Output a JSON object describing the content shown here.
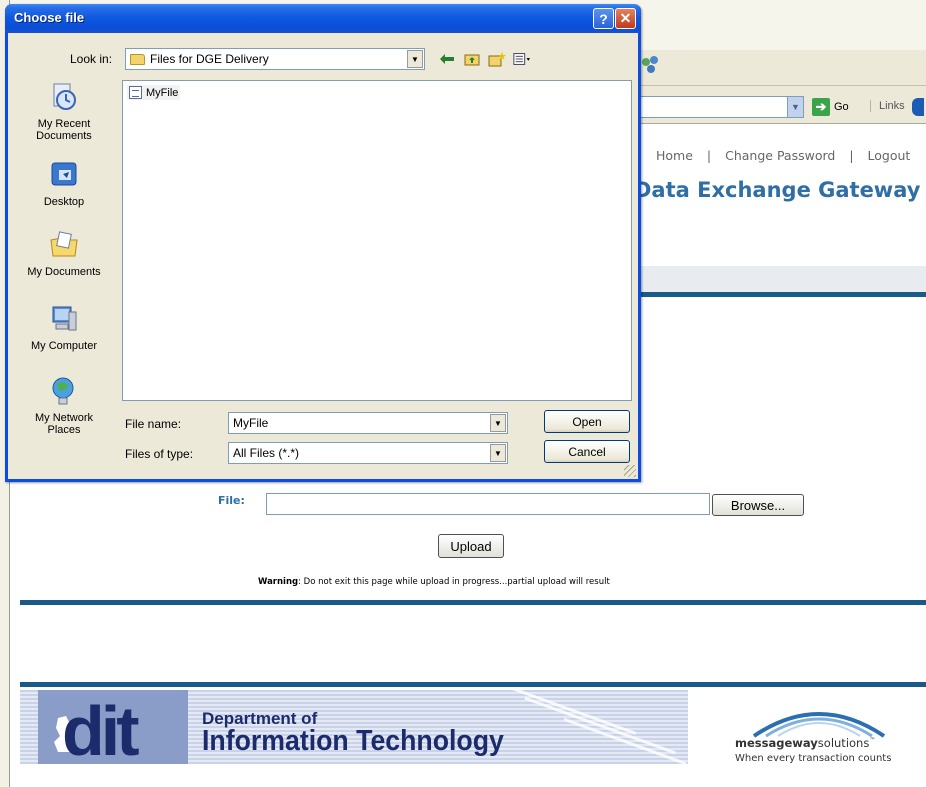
{
  "browser": {
    "go_label": "Go",
    "links_label": "Links"
  },
  "page": {
    "nav": {
      "home": "Home",
      "separator": "|",
      "change_password": "Change Password",
      "logout": "Logout"
    },
    "title_partial": "Data Exchange Gateway",
    "file_label": "File:",
    "file_value": "",
    "browse_label": "Browse...",
    "upload_label": "Upload",
    "warning_bold": "Warning",
    "warning_text": ": Do not exit this page while upload in progress...partial upload will result"
  },
  "footer": {
    "dit_letters": "dit",
    "dit_line1": "Department of",
    "dit_line2": "Information Technology",
    "mw_name_bold": "messageway",
    "mw_name_rest": "solutions",
    "mw_tm": "™",
    "mw_tagline": "When every transaction counts"
  },
  "dialog": {
    "title": "Choose file",
    "help_label": "?",
    "close_label": "✕",
    "look_in_label": "Look in:",
    "look_in_value": "Files for DGE Delivery",
    "places": [
      {
        "label": "My Recent Documents",
        "icon": "recent-documents-icon"
      },
      {
        "label": "Desktop",
        "icon": "desktop-icon"
      },
      {
        "label": "My Documents",
        "icon": "my-documents-icon"
      },
      {
        "label": "My Computer",
        "icon": "my-computer-icon"
      },
      {
        "label": "My Network Places",
        "icon": "network-places-icon"
      }
    ],
    "files": [
      {
        "name": "MyFile"
      }
    ],
    "file_name_label": "File name:",
    "file_name_value": "MyFile",
    "files_of_type_label": "Files of type:",
    "files_of_type_value": "All Files (*.*)",
    "open_label": "Open",
    "cancel_label": "Cancel"
  },
  "colors": {
    "titlebar": "#0a4ed6",
    "accent_blue": "#2f6fa5",
    "rule_blue": "#1a5a8a",
    "dialog_bg": "#ece9d8"
  }
}
